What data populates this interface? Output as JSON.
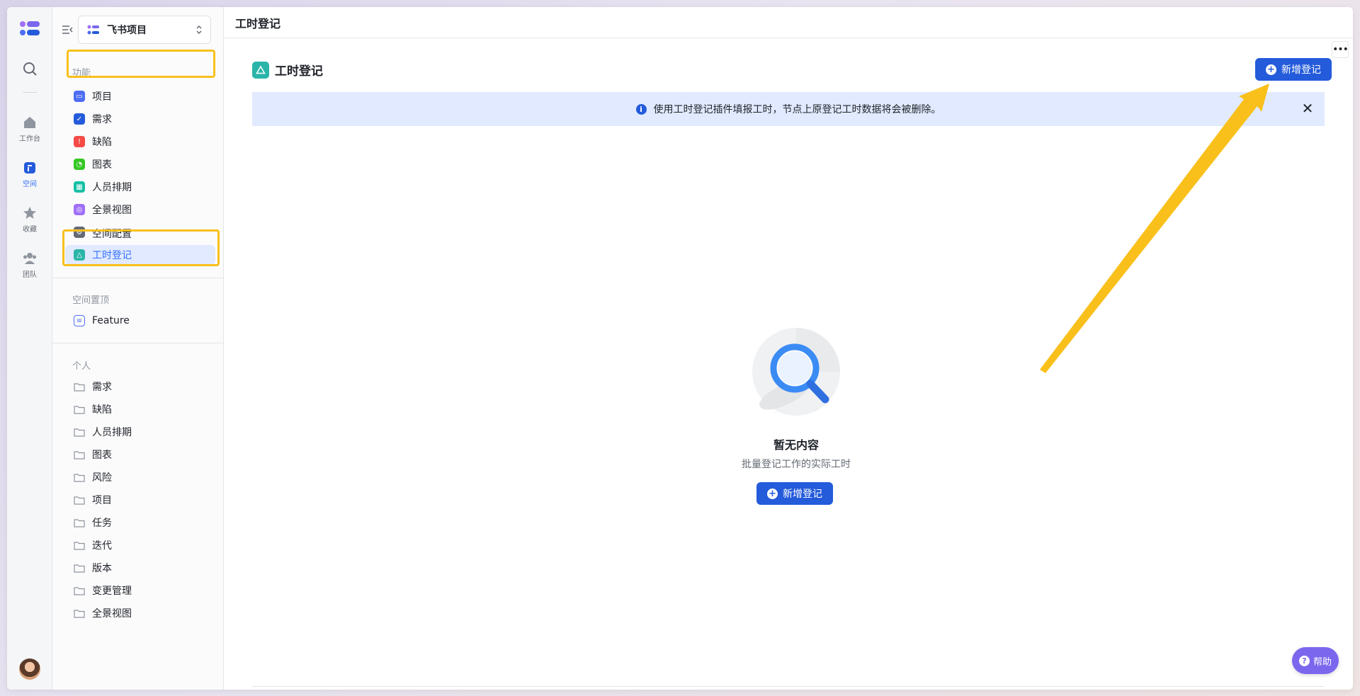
{
  "rail": {
    "items": [
      {
        "label": "工作台",
        "icon": "home-icon"
      },
      {
        "label": "空间",
        "icon": "space-icon"
      },
      {
        "label": "收藏",
        "icon": "star-icon"
      },
      {
        "label": "团队",
        "icon": "team-icon"
      }
    ]
  },
  "sidebar": {
    "project_name": "飞书项目",
    "features_title": "功能",
    "features": [
      {
        "label": "项目",
        "color": "#4e6ef2"
      },
      {
        "label": "需求",
        "color": "#245bdb"
      },
      {
        "label": "缺陷",
        "color": "#f54a45"
      },
      {
        "label": "图表",
        "color": "#34c724"
      },
      {
        "label": "人员排期",
        "color": "#14c0a4"
      },
      {
        "label": "全景视图",
        "color": "#9f6ff8"
      },
      {
        "label": "空间配置",
        "color": "#646a73"
      },
      {
        "label": "工时登记",
        "color": "#2bb5a9"
      }
    ],
    "pinned_title": "空间置顶",
    "pinned": [
      {
        "label": "Feature"
      }
    ],
    "personal_title": "个人",
    "personal": [
      {
        "label": "需求"
      },
      {
        "label": "缺陷"
      },
      {
        "label": "人员排期"
      },
      {
        "label": "图表"
      },
      {
        "label": "风险"
      },
      {
        "label": "项目"
      },
      {
        "label": "任务"
      },
      {
        "label": "迭代"
      },
      {
        "label": "版本"
      },
      {
        "label": "变更管理"
      },
      {
        "label": "全景视图"
      }
    ]
  },
  "main": {
    "topbar_title": "工时登记",
    "page_title": "工时登记",
    "add_button_label": "新增登记",
    "banner_text": "使用工时登记插件填报工时，节点上原登记工时数据将会被删除。",
    "empty_title": "暂无内容",
    "empty_subtitle": "批量登记工作的实际工时",
    "empty_button_label": "新增登记",
    "help_label": "帮助"
  },
  "colors": {
    "accent": "#245bdb",
    "highlight": "#f9c01c",
    "help": "#7b67ee"
  }
}
